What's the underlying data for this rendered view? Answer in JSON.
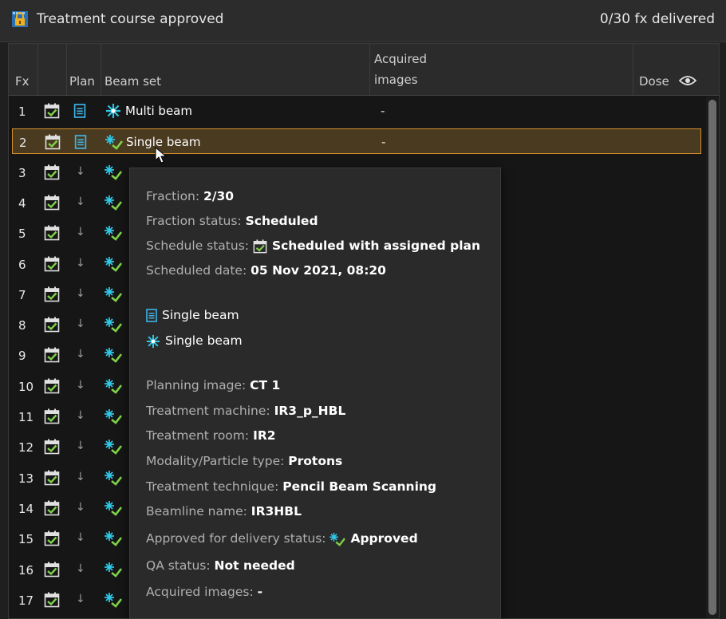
{
  "header": {
    "title": "Treatment course approved",
    "delivered": "0/30 fx delivered"
  },
  "columns": {
    "fx": "Fx",
    "plan": "Plan",
    "beam_set": "Beam set",
    "acquired_line1": "Acquired",
    "acquired_line2": "images",
    "dose": "Dose"
  },
  "rows": [
    {
      "fx": "1",
      "beam_set": "Multi beam",
      "acquired": "-"
    },
    {
      "fx": "2",
      "beam_set": "Single beam",
      "acquired": "-"
    },
    {
      "fx": "3"
    },
    {
      "fx": "4"
    },
    {
      "fx": "5"
    },
    {
      "fx": "6"
    },
    {
      "fx": "7"
    },
    {
      "fx": "8"
    },
    {
      "fx": "9"
    },
    {
      "fx": "10"
    },
    {
      "fx": "11"
    },
    {
      "fx": "12"
    },
    {
      "fx": "13"
    },
    {
      "fx": "14"
    },
    {
      "fx": "15"
    },
    {
      "fx": "16"
    },
    {
      "fx": "17"
    }
  ],
  "tooltip": {
    "fraction_label": "Fraction:",
    "fraction_value": "2/30",
    "fraction_status_label": "Fraction status:",
    "fraction_status_value": "Scheduled",
    "schedule_status_label": "Schedule status:",
    "schedule_status_value": "Scheduled with assigned plan",
    "scheduled_date_label": "Scheduled date:",
    "scheduled_date_value": "05 Nov 2021, 08:20",
    "plan_name": "Single beam",
    "beam_set_name": "Single beam",
    "planning_image_label": "Planning image:",
    "planning_image_value": "CT 1",
    "treatment_machine_label": "Treatment machine:",
    "treatment_machine_value": "IR3_p_HBL",
    "treatment_room_label": "Treatment room:",
    "treatment_room_value": "IR2",
    "modality_label": "Modality/Particle type:",
    "modality_value": "Protons",
    "technique_label": "Treatment technique:",
    "technique_value": "Pencil Beam Scanning",
    "beamline_label": "Beamline name:",
    "beamline_value": "IR3HBL",
    "approved_label": "Approved for delivery status:",
    "approved_value": "Approved",
    "qa_label": "QA status:",
    "qa_value": "Not needed",
    "acquired_label": "Acquired images:",
    "acquired_value": "-"
  },
  "colors": {
    "selected_border": "#d28f2b",
    "calendar_green": "#7fd24a",
    "plan_blue": "#3fb4e6",
    "beam_cyan": "#2ec7e6"
  }
}
